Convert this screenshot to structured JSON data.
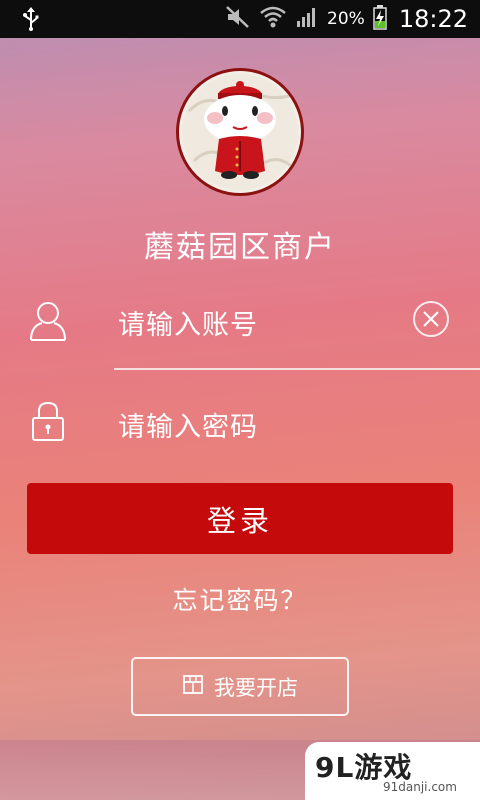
{
  "status_bar": {
    "battery_percent": "20%",
    "time": "18:22",
    "icons": [
      "usb-icon",
      "mute-icon",
      "wifi-icon",
      "signal-icon",
      "battery-charging-icon"
    ]
  },
  "merchant": {
    "title": "蘑菇园区商户"
  },
  "form": {
    "account_placeholder": "请输入账号",
    "password_placeholder": "请输入密码",
    "login_label": "登录",
    "forgot_label": "忘记密码？"
  },
  "open_shop": {
    "label": "我要开店"
  },
  "watermark": {
    "main": "9L游戏",
    "sub": "91danji.com"
  },
  "colors": {
    "accent": "#c40a0a",
    "statusbar": "#0d0d0d",
    "text": "#ffffff"
  }
}
